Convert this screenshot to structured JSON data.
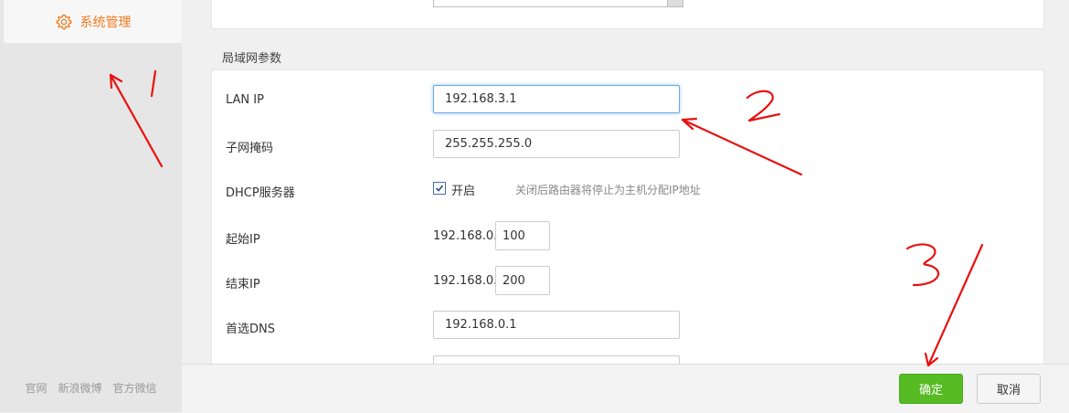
{
  "sidebar": {
    "active_item": {
      "label": "系统管理",
      "icon": "gear-icon"
    },
    "footer_links": [
      "官网",
      "新浪微博",
      "官方微信"
    ]
  },
  "lan_section": {
    "title": "局域网参数",
    "lan_ip": {
      "label": "LAN IP",
      "value": "192.168.3.1"
    },
    "subnet_mask": {
      "label": "子网掩码",
      "value": "255.255.255.0"
    },
    "dhcp": {
      "label": "DHCP服务器",
      "checked": true,
      "checkbox_label": "开启",
      "hint": "关闭后路由器将停止为主机分配IP地址"
    },
    "start_ip": {
      "label": "起始IP",
      "prefix": "192.168.0.",
      "value": "100"
    },
    "end_ip": {
      "label": "结束IP",
      "prefix": "192.168.0.",
      "value": "200"
    },
    "primary_dns": {
      "label": "首选DNS",
      "value": "192.168.0.1"
    },
    "secondary_dns": {
      "value": ""
    }
  },
  "actions": {
    "confirm_label": "确定",
    "cancel_label": "取消"
  },
  "colors": {
    "accent": "#f07a1e",
    "confirm": "#57bb23",
    "annotation": "#e8110f"
  }
}
